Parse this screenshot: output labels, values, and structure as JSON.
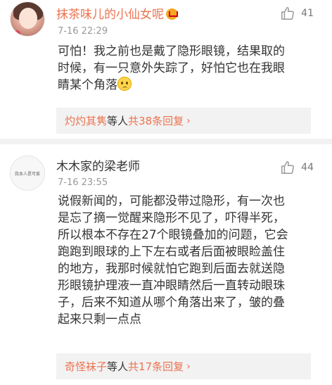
{
  "comments": [
    {
      "username": "抹茶味儿的小仙女呢",
      "time": "7-16 22:29",
      "likes": "41",
      "text_lines": [
        "可怕！我之前也是戴了隐形眼镜，结果取的",
        "时候，有一只意外失踪了，好怕它也在我眼",
        "睛某个角落"
      ],
      "reply": {
        "names": "灼灼其隽",
        "mid": "等人",
        "count": "共38条回复",
        "chevron": "›"
      }
    },
    {
      "username": "木木家的梁老师",
      "avatar_text": "我本人是可爱",
      "time": "7-16 23:55",
      "likes": "44",
      "text_lines": [
        "说假新闻的，可能都没带过隐形，有一次也",
        "是忘了摘一觉醒来隐形不见了，吓得半死，",
        "所以根本不存在27个眼镜叠加的问题，它会",
        "跑跑到眼球的上下左右或者后面被眼睑盖住",
        "的地方，我那时候就怕它跑到后面去就送隐",
        "形眼镜护理液一直冲眼睛然后一直转动眼珠",
        "子，后来不知道从哪个角落出来了，皱的叠",
        "起来只剩一点点"
      ],
      "reply": {
        "names": "奇怪袜子",
        "mid": "等人",
        "count": "共17条回复",
        "chevron": "›"
      }
    }
  ],
  "colors": {
    "accent": "#eb7350",
    "text": "#333333",
    "meta": "#999999",
    "reply_bg": "#f2f2f2"
  },
  "icons": [
    "thumb-up-icon",
    "crown-icon",
    "sad-face-icon",
    "chevron-right-icon"
  ]
}
